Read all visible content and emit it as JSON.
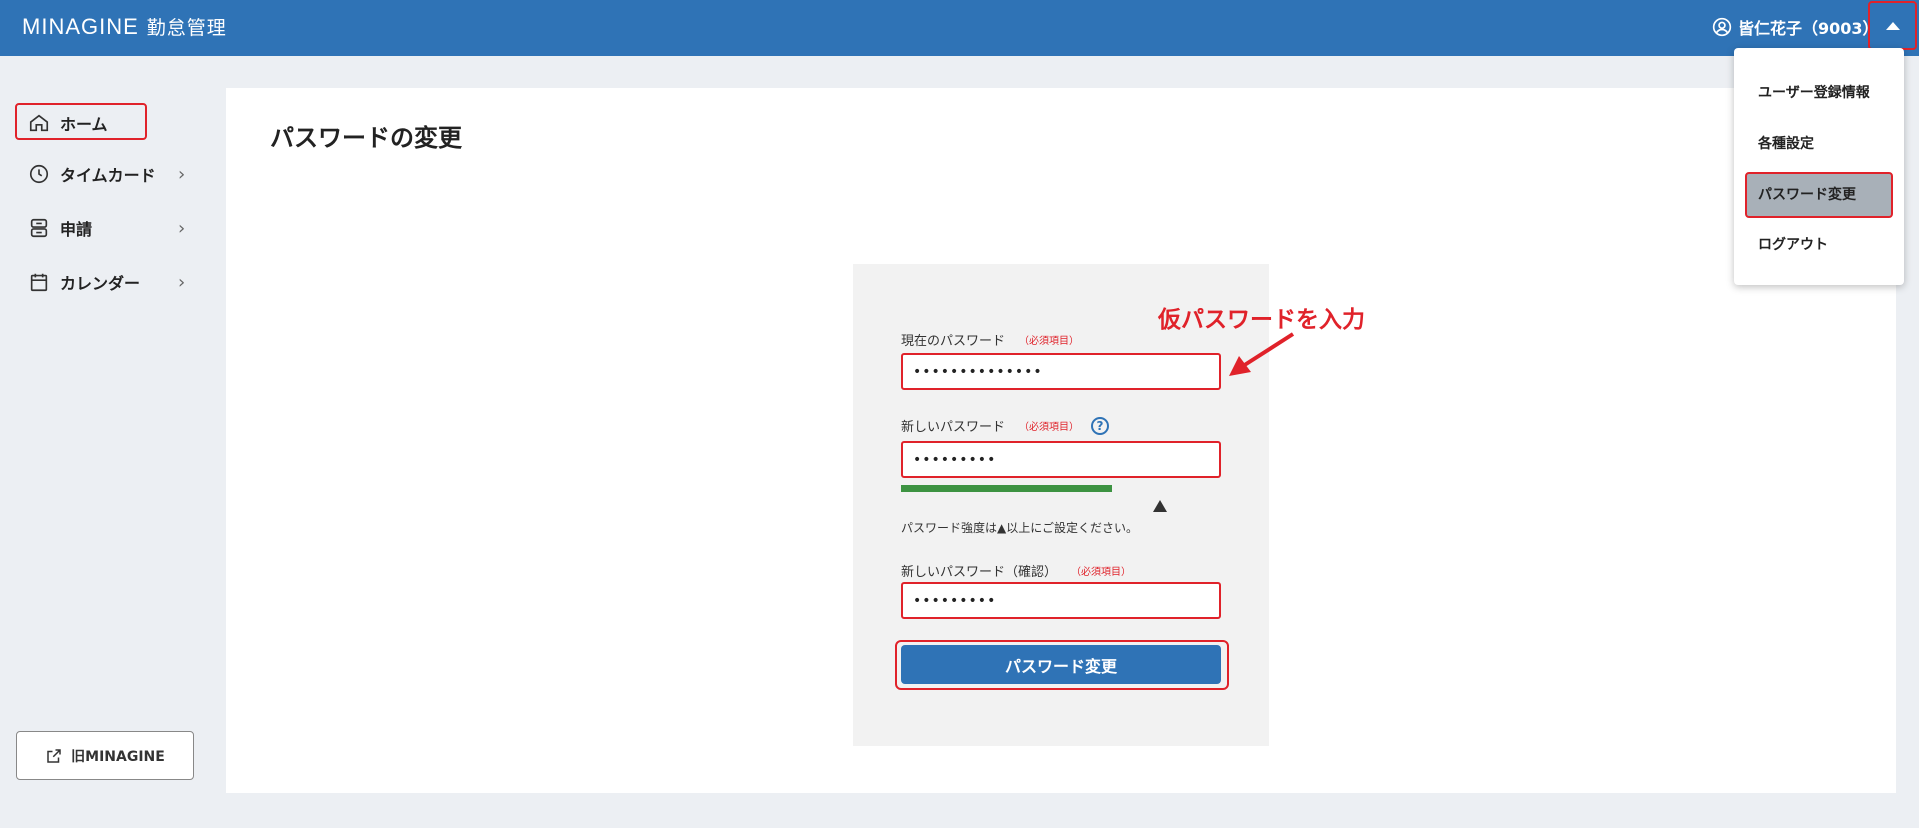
{
  "header": {
    "logo": "MINAGINE",
    "app_name": "勤怠管理",
    "user_name": "皆仁花子（9003）"
  },
  "sidebar": {
    "items": [
      {
        "label": "ホーム",
        "icon": "home-icon"
      },
      {
        "label": "タイムカード",
        "icon": "clock-icon"
      },
      {
        "label": "申請",
        "icon": "inbox-icon"
      },
      {
        "label": "カレンダー",
        "icon": "calendar-icon"
      }
    ],
    "old_link_label": "旧MINAGINE"
  },
  "main": {
    "title": "パスワードの変更",
    "form": {
      "current_label": "現在のパスワード",
      "current_required": "（必須項目）",
      "current_value": "••••••••••••••",
      "new_label": "新しいパスワード",
      "new_required": "（必須項目）",
      "help_symbol": "?",
      "new_value": "•••••••••",
      "strength_fraction": 0.81,
      "strength_hint": "パスワード強度は▲以上にご設定ください。",
      "confirm_label": "新しいパスワード（確認）",
      "confirm_required": "（必須項目）",
      "confirm_value": "•••••••••",
      "submit_label": "パスワード変更"
    }
  },
  "annotation": {
    "text": "仮パスワードを入力"
  },
  "dropdown": {
    "items": [
      "ユーザー登録情報",
      "各種設定",
      "パスワード変更",
      "ログアウト"
    ]
  },
  "colors": {
    "header_bg": "#2f73b6",
    "highlight_red": "#e0222a",
    "strength_green": "#3d9342",
    "page_bg": "#eceff3"
  }
}
